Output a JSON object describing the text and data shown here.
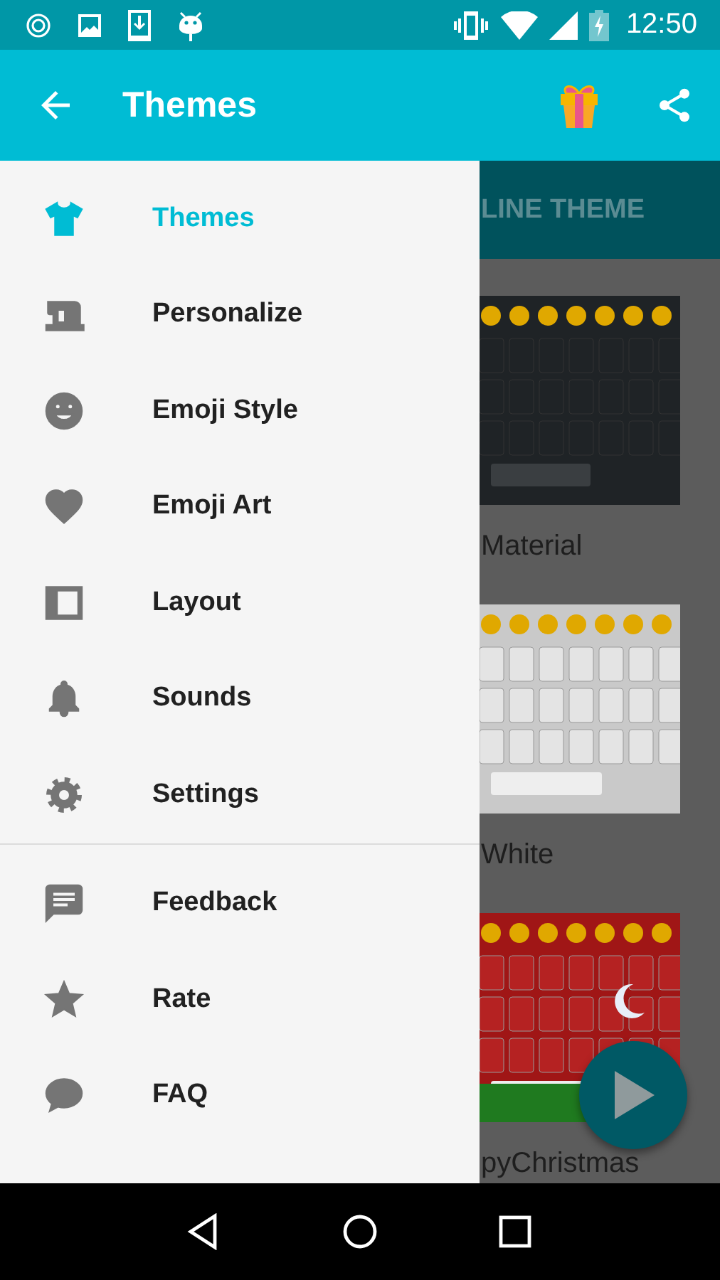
{
  "status_bar": {
    "time": "12:50"
  },
  "app_bar": {
    "title": "Themes"
  },
  "drawer": {
    "sections": [
      {
        "items": [
          {
            "label": "Themes",
            "selected": true
          },
          {
            "label": "Personalize",
            "selected": false
          },
          {
            "label": "Emoji Style",
            "selected": false
          },
          {
            "label": "Emoji Art",
            "selected": false
          },
          {
            "label": "Layout",
            "selected": false
          },
          {
            "label": "Sounds",
            "selected": false
          },
          {
            "label": "Settings",
            "selected": false
          }
        ]
      },
      {
        "items": [
          {
            "label": "Feedback",
            "selected": false
          },
          {
            "label": "Rate",
            "selected": false
          },
          {
            "label": "FAQ",
            "selected": false
          }
        ]
      }
    ]
  },
  "background": {
    "tab": {
      "label": "LINE THEME"
    },
    "themes": [
      {
        "name": "Material"
      },
      {
        "name": "White"
      },
      {
        "name": "pyChristmas"
      }
    ]
  }
}
